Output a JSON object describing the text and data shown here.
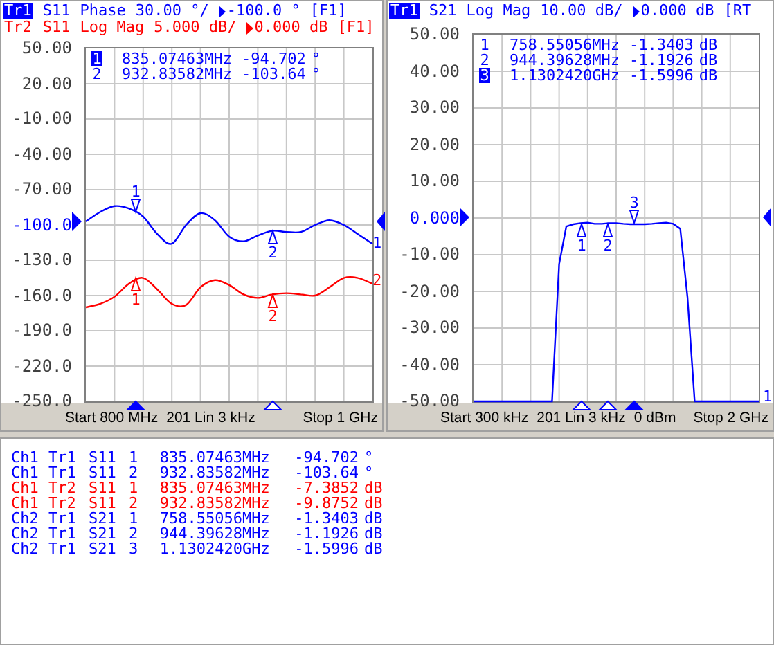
{
  "channels": [
    {
      "traces": [
        {
          "selected": true,
          "color": "#0000ff",
          "param": "S11",
          "format": "Phase",
          "scale": "30.00 °/",
          "ref": "-100.0 °",
          "flag": "[F1]",
          "end_label": "1",
          "markers": [
            {
              "label": "1"
            },
            {
              "label": "2"
            }
          ]
        },
        {
          "selected": false,
          "color": "#ff0000",
          "param": "S11",
          "format": "Log Mag",
          "scale": "5.000 dB/",
          "ref": "0.000 dB",
          "flag": "[F1]",
          "end_label": "2",
          "markers": [
            {
              "label": "1"
            },
            {
              "label": "2"
            }
          ]
        }
      ],
      "y_ticks": [
        {
          "reference": false
        },
        {
          "reference": false
        },
        {
          "reference": false
        },
        {
          "reference": false
        },
        {
          "reference": false
        },
        {
          "reference": true
        },
        {
          "reference": false
        },
        {
          "reference": false
        },
        {
          "reference": false
        },
        {
          "reference": false
        },
        {
          "reference": false
        }
      ],
      "chart_data": {
        "type": "line",
        "grid": true,
        "categories": [
          null,
          null,
          null,
          null,
          null,
          null,
          null,
          null,
          null,
          null,
          null,
          null,
          null,
          null,
          null,
          null,
          null,
          null,
          null,
          null,
          null
        ],
        "ylim": [
          -250,
          50
        ],
        "yticks": [
          {
            "value": 50,
            "label": "50.00"
          },
          {
            "value": 20,
            "label": "20.00"
          },
          {
            "value": -10,
            "label": "-10.00"
          },
          {
            "value": -40,
            "label": "-40.00"
          },
          {
            "value": -70,
            "label": "-70.00"
          },
          {
            "value": -100,
            "label": "-100.0"
          },
          {
            "value": -130,
            "label": "-130.0"
          },
          {
            "value": -160,
            "label": "-160.0"
          },
          {
            "value": -190,
            "label": "-190.0"
          },
          {
            "value": -220,
            "label": "-220.0"
          },
          {
            "value": -250,
            "label": "-250.0"
          }
        ],
        "series": [
          {
            "name": "Tr1",
            "color": "#0000ff",
            "values": [
              -97,
              -89,
              -84,
              -86,
              -93,
              -108,
              -116,
              -100,
              -90,
              -96,
              -110,
              -114,
              -109,
              -105,
              -106,
              -106,
              -100,
              -96,
              -100,
              -108,
              -116
            ]
          },
          {
            "name": "Tr2",
            "color": "#ff0000",
            "values": [
              -170,
              -167,
              -161,
              -150,
              -145,
              -155,
              -167,
              -168,
              -153,
              -147,
              -151,
              -159,
              -162,
              -159,
              -158,
              -159,
              -160,
              -153,
              -145,
              -145,
              -150
            ]
          }
        ]
      },
      "readout": [
        {
          "number": "1",
          "active": true,
          "freq": "835.07463",
          "freq_unit": "MHz",
          "value": "-94.702",
          "value_unit": "°"
        },
        {
          "number": "2",
          "active": false,
          "freq": "932.83582",
          "freq_unit": "MHz",
          "value": "-103.64",
          "value_unit": "°"
        }
      ],
      "footer": [
        "Start 800 MHz",
        "201 Lin 3 kHz",
        "Stop 1 GHz"
      ]
    },
    {
      "traces": [
        {
          "selected": true,
          "color": "#0000ff",
          "param": "S21",
          "format": "Log Mag",
          "scale": "10.00 dB/",
          "ref": "0.000 dB",
          "flag": "[RT",
          "end_label": "1",
          "markers": [
            {
              "label": "1"
            },
            {
              "label": "2"
            },
            {
              "label": "3"
            }
          ]
        }
      ],
      "y_ticks": [
        {
          "reference": false
        },
        {
          "reference": false
        },
        {
          "reference": false
        },
        {
          "reference": false
        },
        {
          "reference": false
        },
        {
          "reference": true
        },
        {
          "reference": false
        },
        {
          "reference": false
        },
        {
          "reference": false
        },
        {
          "reference": false
        },
        {
          "reference": false
        }
      ],
      "chart_data": {
        "type": "line",
        "grid": true,
        "categories": [
          null,
          null,
          null,
          null,
          null,
          null,
          null,
          null,
          null,
          null,
          null,
          null,
          null,
          null,
          null,
          null,
          null,
          null,
          null,
          null,
          null,
          null,
          null,
          null,
          null,
          null,
          null,
          null,
          null,
          null,
          null,
          null,
          null,
          null,
          null,
          null,
          null,
          null,
          null,
          null,
          null
        ],
        "ylim": [
          -50,
          50
        ],
        "yticks": [
          {
            "value": 50,
            "label": "50.00"
          },
          {
            "value": 40,
            "label": "40.00"
          },
          {
            "value": 30,
            "label": "30.00"
          },
          {
            "value": 20,
            "label": "20.00"
          },
          {
            "value": 10,
            "label": "10.00"
          },
          {
            "value": 0,
            "label": "0.000"
          },
          {
            "value": -10,
            "label": "-10.00"
          },
          {
            "value": -20,
            "label": "-20.00"
          },
          {
            "value": -30,
            "label": "-30.00"
          },
          {
            "value": -40,
            "label": "-40.00"
          },
          {
            "value": -50,
            "label": "-50.00"
          }
        ],
        "series": [
          {
            "name": "Tr1",
            "color": "#0000ff",
            "values": [
              -50,
              -50,
              -50,
              -50,
              -50,
              -50,
              -50,
              -50,
              -50,
              -50,
              -50,
              -50,
              -12.6,
              -2.3,
              -1.7,
              -1.4,
              -1.3,
              -1.6,
              -1.6,
              -1.4,
              -1.4,
              -1.6,
              -1.7,
              -1.7,
              -1.7,
              -1.6,
              -1.4,
              -1.3,
              -1.6,
              -2.9,
              -21.5,
              -50,
              -50,
              -50,
              -50,
              -50,
              -50,
              -50,
              -50,
              -50,
              -50
            ]
          }
        ]
      },
      "readout": [
        {
          "number": "1",
          "active": false,
          "freq": "758.55056",
          "freq_unit": "MHz",
          "value": "-1.3403",
          "value_unit": "dB"
        },
        {
          "number": "2",
          "active": false,
          "freq": "944.39628",
          "freq_unit": "MHz",
          "value": "-1.1926",
          "value_unit": "dB"
        },
        {
          "number": "3",
          "active": true,
          "freq": "1.1302420",
          "freq_unit": "GHz",
          "value": "-1.5996",
          "value_unit": "dB"
        }
      ],
      "footer": [
        "Start 300 kHz",
        "201 Lin 3 kHz",
        "0 dBm",
        "Stop 2 GHz"
      ]
    }
  ],
  "marker_table": [
    {
      "channel": "Ch1",
      "trace": "Tr1",
      "param": "S11",
      "marker": "1",
      "freq": "835.07463",
      "freq_unit": "MHz",
      "value": "-94.702",
      "value_unit": "°",
      "color": "#0000ff"
    },
    {
      "channel": "Ch1",
      "trace": "Tr1",
      "param": "S11",
      "marker": "2",
      "freq": "932.83582",
      "freq_unit": "MHz",
      "value": "-103.64",
      "value_unit": "°",
      "color": "#0000ff"
    },
    {
      "channel": "Ch1",
      "trace": "Tr2",
      "param": "S11",
      "marker": "1",
      "freq": "835.07463",
      "freq_unit": "MHz",
      "value": "-7.3852",
      "value_unit": "dB",
      "color": "#ff0000"
    },
    {
      "channel": "Ch1",
      "trace": "Tr2",
      "param": "S11",
      "marker": "2",
      "freq": "932.83582",
      "freq_unit": "MHz",
      "value": "-9.8752",
      "value_unit": "dB",
      "color": "#ff0000"
    },
    {
      "channel": "Ch2",
      "trace": "Tr1",
      "param": "S21",
      "marker": "1",
      "freq": "758.55056",
      "freq_unit": "MHz",
      "value": "-1.3403",
      "value_unit": "dB",
      "color": "#0000ff"
    },
    {
      "channel": "Ch2",
      "trace": "Tr1",
      "param": "S21",
      "marker": "2",
      "freq": "944.39628",
      "freq_unit": "MHz",
      "value": "-1.1926",
      "value_unit": "dB",
      "color": "#0000ff"
    },
    {
      "channel": "Ch2",
      "trace": "Tr1",
      "param": "S21",
      "marker": "3",
      "freq": "1.1302420",
      "freq_unit": "GHz",
      "value": "-1.5996",
      "value_unit": "dB",
      "color": "#0000ff"
    }
  ]
}
